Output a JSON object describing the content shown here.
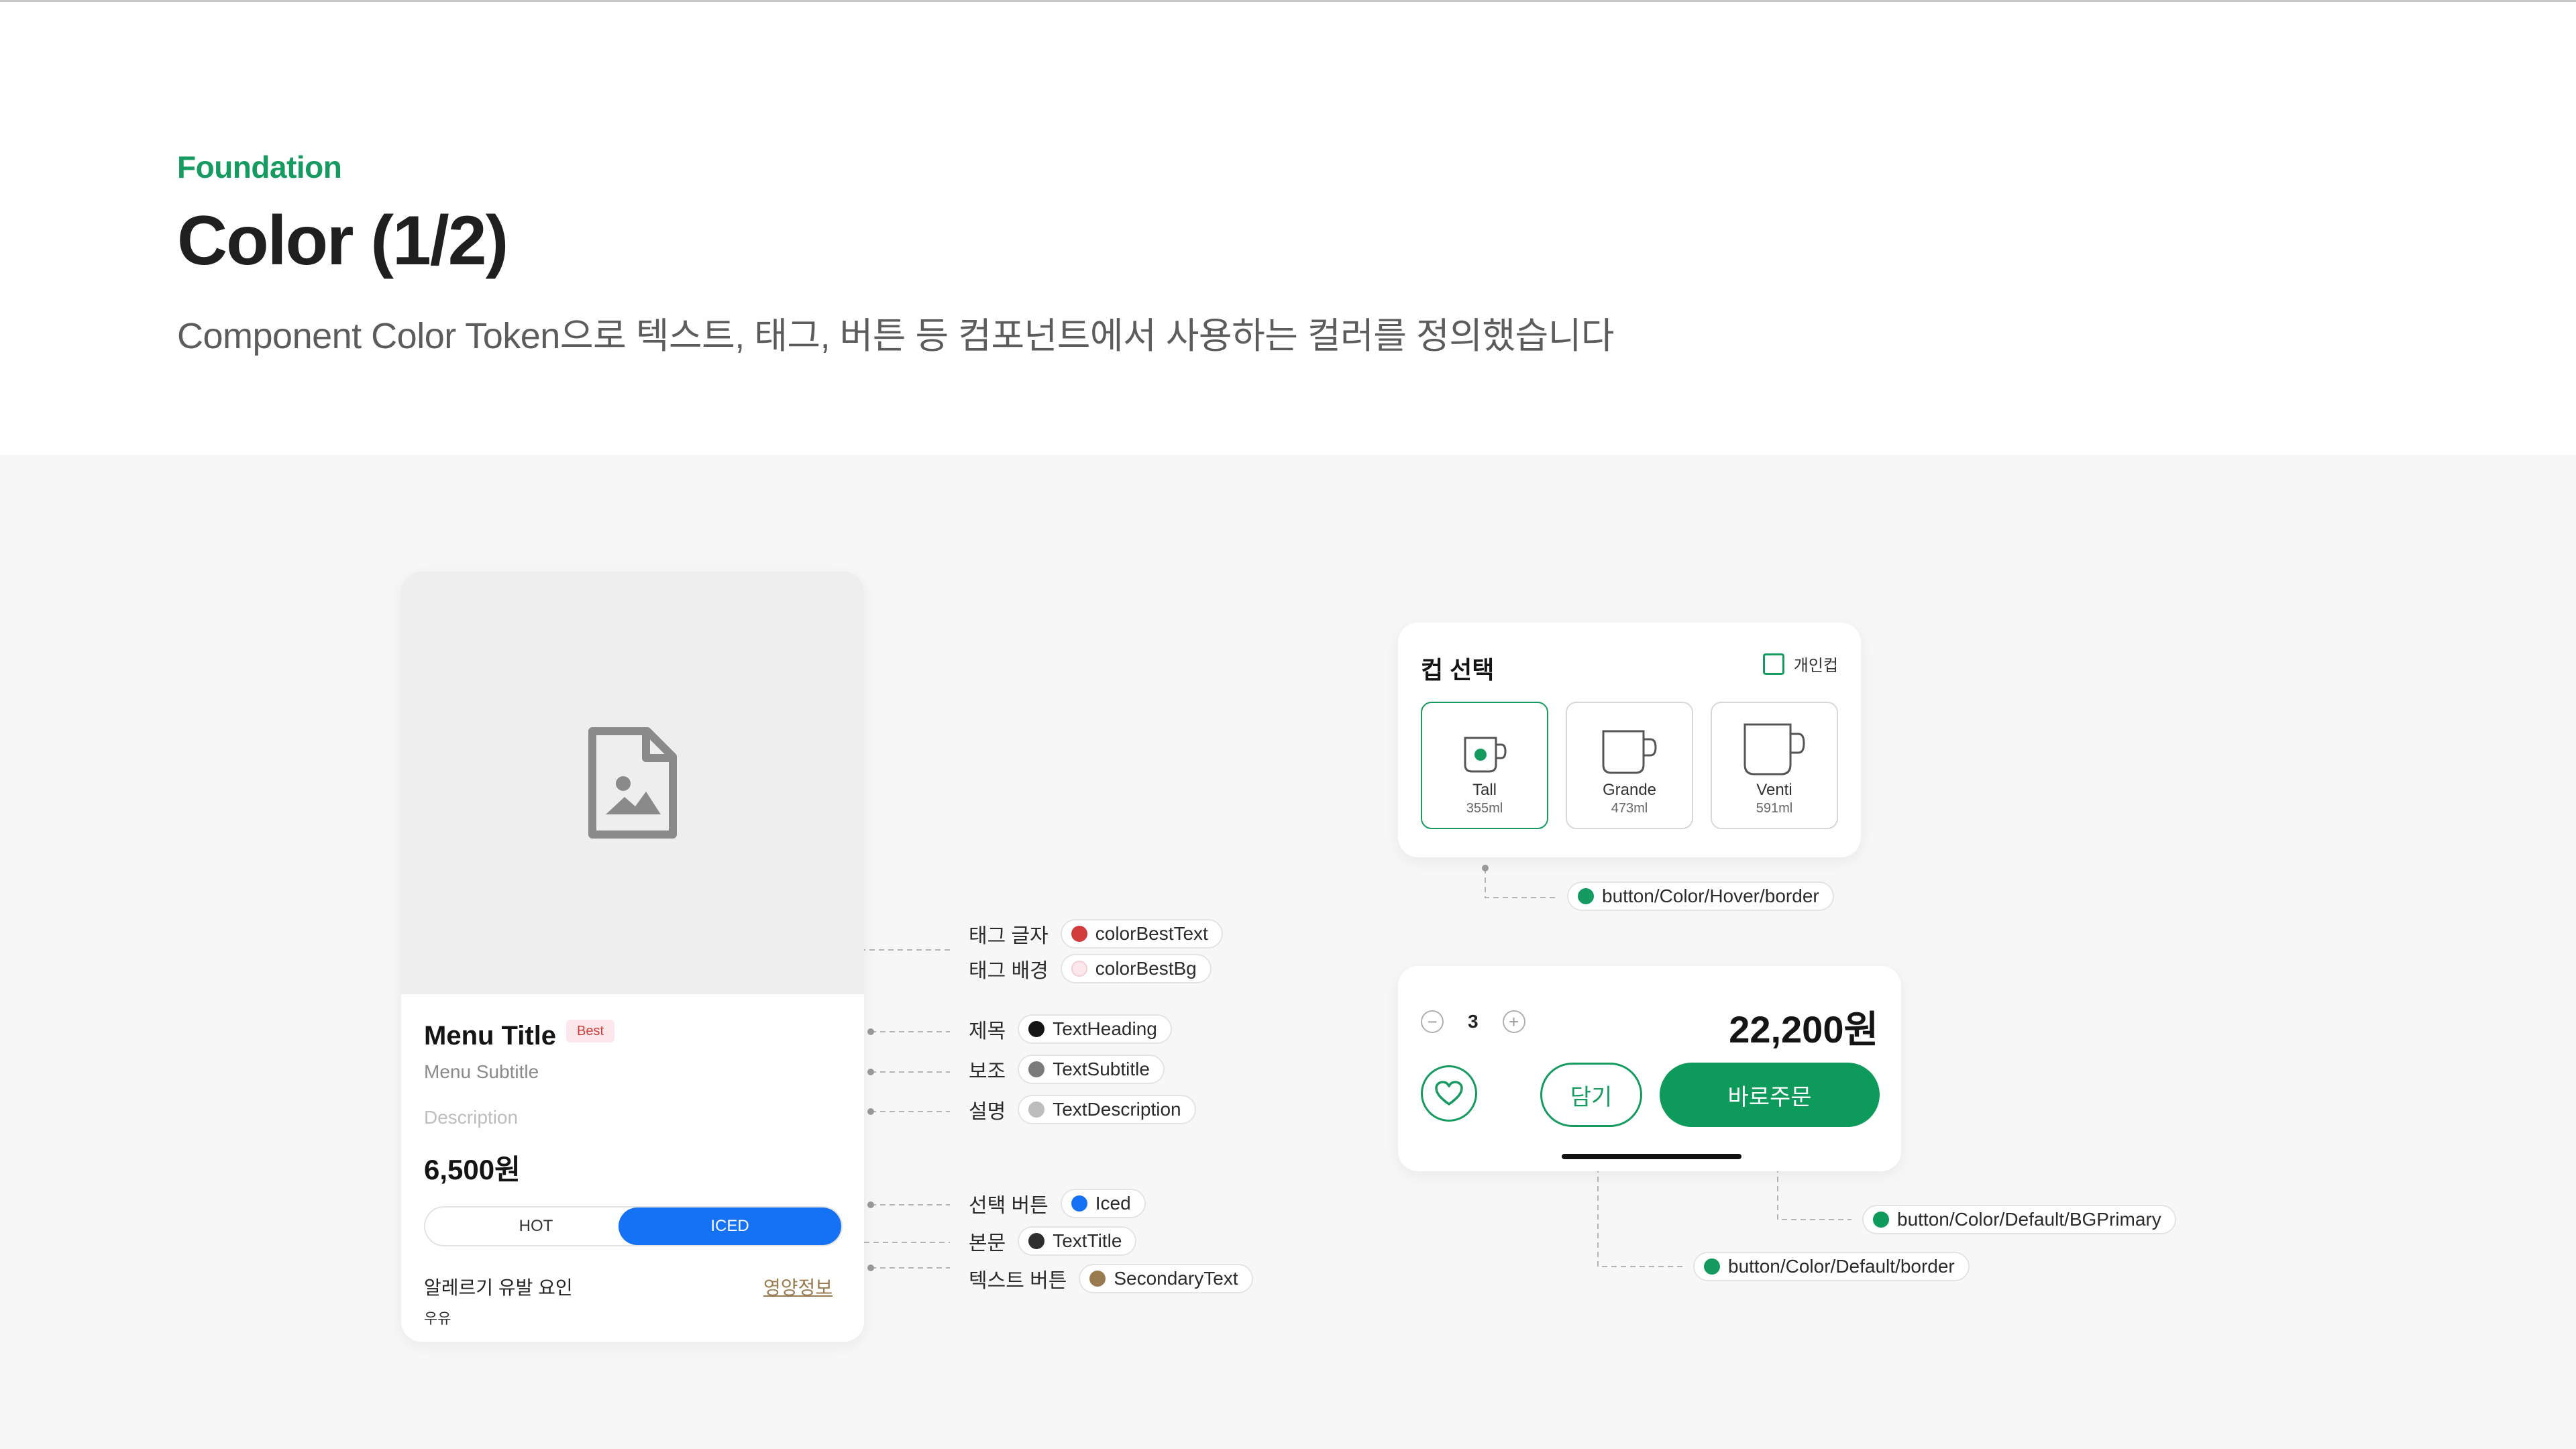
{
  "header": {
    "eyebrow": "Foundation",
    "title": "Color (1/2)",
    "subtitle": "Component Color Token으로 텍스트, 태그, 버튼 등 컴포넌트에서 사용하는 컬러를 정의했습니다"
  },
  "menu_card": {
    "title": "Menu Title",
    "tag": "Best",
    "subtitle": "Menu Subtitle",
    "description": "Description",
    "price": "6,500원",
    "toggle_hot": "HOT",
    "toggle_iced": "ICED",
    "allergy_label": "알레르기 유발 요인",
    "allergy_value": "우유",
    "nutrition_link": "영양정보"
  },
  "annotations": {
    "tag_text": {
      "label": "태그 글자",
      "token": "colorBestText",
      "color": "#d23b3b"
    },
    "tag_bg": {
      "label": "태그 배경",
      "token": "colorBestBg",
      "color": "#fce8ea"
    },
    "heading": {
      "label": "제목",
      "token": "TextHeading",
      "color": "#141414"
    },
    "subtitle": {
      "label": "보조",
      "token": "TextSubtitle",
      "color": "#7a7a7a"
    },
    "description": {
      "label": "설명",
      "token": "TextDescription",
      "color": "#bdbdbd"
    },
    "selected_button": {
      "label": "선택 버튼",
      "token": "Iced",
      "color": "#1672f5"
    },
    "body": {
      "label": "본문",
      "token": "TextTitle",
      "color": "#2e2e2e"
    },
    "text_button": {
      "label": "텍스트 버튼",
      "token": "SecondaryText",
      "color": "#9a7b4f"
    },
    "hover_border": {
      "token": "button/Color/Hover/border",
      "color": "#159b5f"
    },
    "bg_primary": {
      "token": "button/Color/Default/BGPrimary",
      "color": "#0d9a5b"
    },
    "default_border": {
      "token": "button/Color/Default/border",
      "color": "#159b5f"
    }
  },
  "cup_card": {
    "title": "컵 선택",
    "personal_cup": "개인컵",
    "options": [
      {
        "name": "Tall",
        "volume": "355ml"
      },
      {
        "name": "Grande",
        "volume": "473ml"
      },
      {
        "name": "Venti",
        "volume": "591ml"
      }
    ]
  },
  "order_card": {
    "quantity": "3",
    "price": "22,200원",
    "cart_label": "담기",
    "buy_label": "바로주문"
  },
  "colors": {
    "brand_green": "#159b5f",
    "primary_green": "#0d9a5b",
    "iced_blue": "#1672f5"
  }
}
